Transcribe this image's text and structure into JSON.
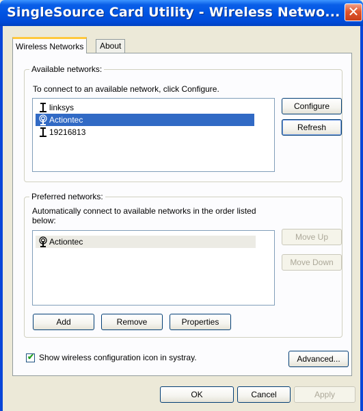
{
  "window": {
    "title": "SingleSource Card Utility - Wireless Netwo...",
    "close_glyph": "✕"
  },
  "tabs": [
    {
      "label": "Wireless Networks",
      "active": true
    },
    {
      "label": "About",
      "active": false
    }
  ],
  "available": {
    "legend": "Available networks:",
    "instruction": "To connect to an available network, click Configure.",
    "networks": [
      {
        "name": "linksys",
        "icon": "antenna-icon",
        "selected": false
      },
      {
        "name": "Actiontec",
        "icon": "wireless-signal-icon",
        "selected": true
      },
      {
        "name": "19216813",
        "icon": "antenna-icon",
        "selected": false
      }
    ],
    "configure_label": "Configure",
    "refresh_label": "Refresh"
  },
  "preferred": {
    "legend": "Preferred networks:",
    "instruction_line1": "Automatically connect to available networks in the order listed",
    "instruction_line2": "below:",
    "networks": [
      {
        "name": "Actiontec",
        "icon": "wireless-signal-icon"
      }
    ],
    "move_up_label": "Move Up",
    "move_down_label": "Move Down",
    "add_label": "Add",
    "remove_label": "Remove",
    "properties_label": "Properties"
  },
  "systray": {
    "checked": true,
    "label": "Show wireless configuration icon in systray."
  },
  "advanced_label": "Advanced...",
  "footer": {
    "ok_label": "OK",
    "cancel_label": "Cancel",
    "apply_label": "Apply"
  }
}
